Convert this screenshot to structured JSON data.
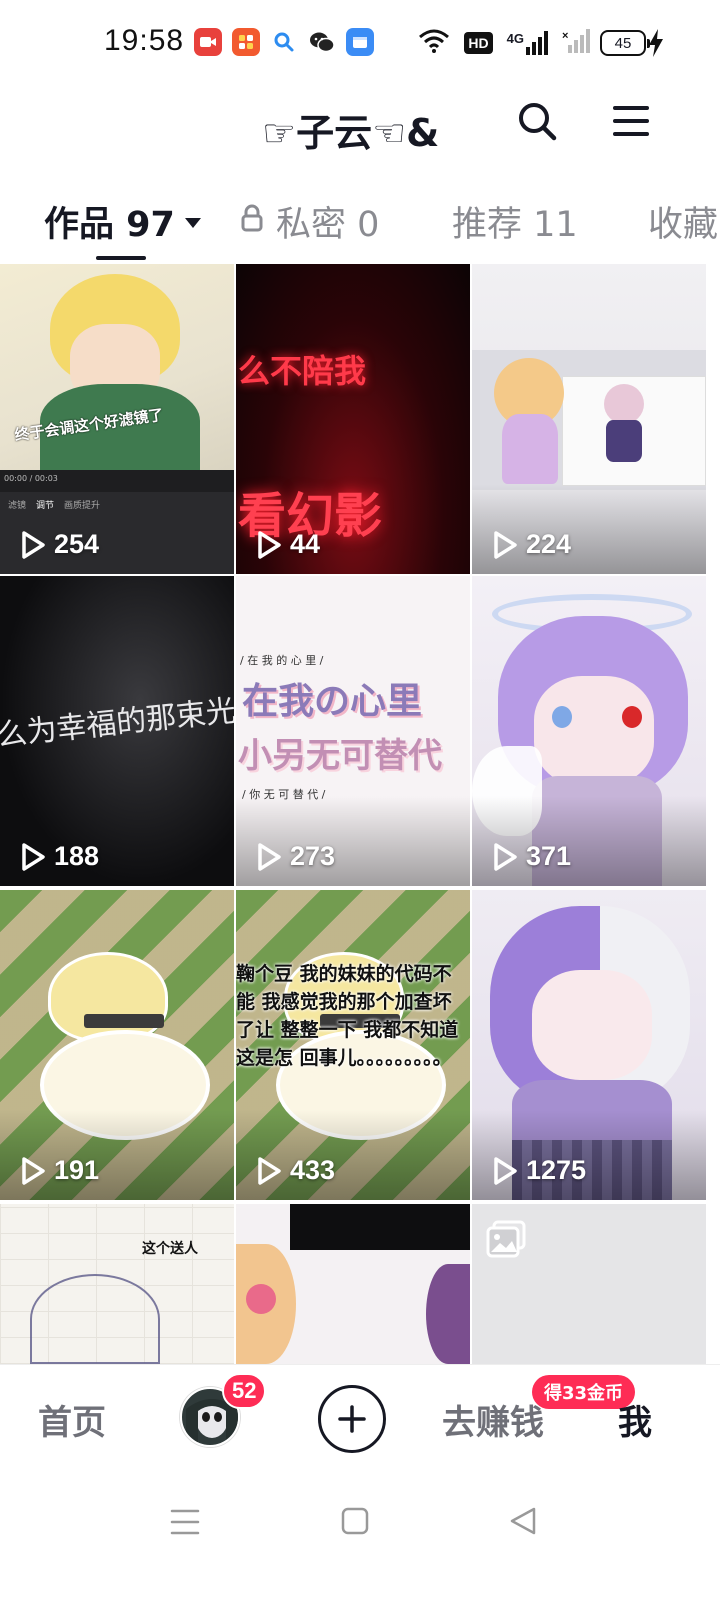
{
  "status_bar": {
    "time": "19:58",
    "hd_label": "HD",
    "network_label": "4G",
    "battery": "45",
    "notification_icons": [
      "screen-record-icon",
      "app-icon",
      "search-icon",
      "wechat-icon",
      "blue-app-icon"
    ],
    "system_icons": [
      "wifi-icon",
      "hd-icon",
      "signal-4g-icon",
      "signal-no-sim-icon",
      "battery-icon",
      "charging-icon"
    ]
  },
  "header": {
    "profile_name": "☞子云☜&",
    "search_icon": "search-icon",
    "menu_icon": "menu-icon"
  },
  "tabs": [
    {
      "label": "作品 97",
      "active": true
    },
    {
      "label": "私密 0",
      "active": false,
      "icon": "lock-icon"
    },
    {
      "label": "推荐 11",
      "active": false
    },
    {
      "label": "收藏",
      "active": false
    }
  ],
  "videos": [
    {
      "views": "254",
      "caption": "终于会调这个好滤镜了",
      "player_time": "00:00 / 00:03",
      "editor_tabs": [
        "滤镜",
        "调节",
        "画质提升"
      ]
    },
    {
      "views": "44",
      "caption_top": "么不陪我",
      "caption_bottom": "看幻影"
    },
    {
      "views": "224"
    },
    {
      "views": "188",
      "caption": "么为幸福的那束光"
    },
    {
      "views": "273",
      "caption_small": "/ 在 我 的 心 里 /",
      "caption_main": "在我の心里",
      "caption_sub": "小另无可替代",
      "caption_footer": "/ 你 无 可 替 代 /"
    },
    {
      "views": "371"
    },
    {
      "views": "191"
    },
    {
      "views": "433",
      "caption": "鞠个豆 我的妹妹的代码不能 我感觉我的那个加查坏了让 整整一下 我都不知道这是怎 回事儿。。。。。。。。。"
    },
    {
      "views": "1275"
    },
    {
      "views": "",
      "caption": "这个送人"
    },
    {
      "views": ""
    },
    {
      "views": "",
      "icon": "image-gallery-icon"
    }
  ],
  "bottom_nav": {
    "home": "首页",
    "message_badge": "52",
    "create_icon": "plus-icon",
    "earn": "去赚钱",
    "earn_badge": "得33金币",
    "me": "我"
  },
  "system_nav": {
    "icons": [
      "recent-apps-icon",
      "home-icon",
      "back-icon"
    ]
  },
  "colors": {
    "accent": "#fe2c55",
    "text_primary": "#161823",
    "text_secondary": "#8a8b91"
  }
}
